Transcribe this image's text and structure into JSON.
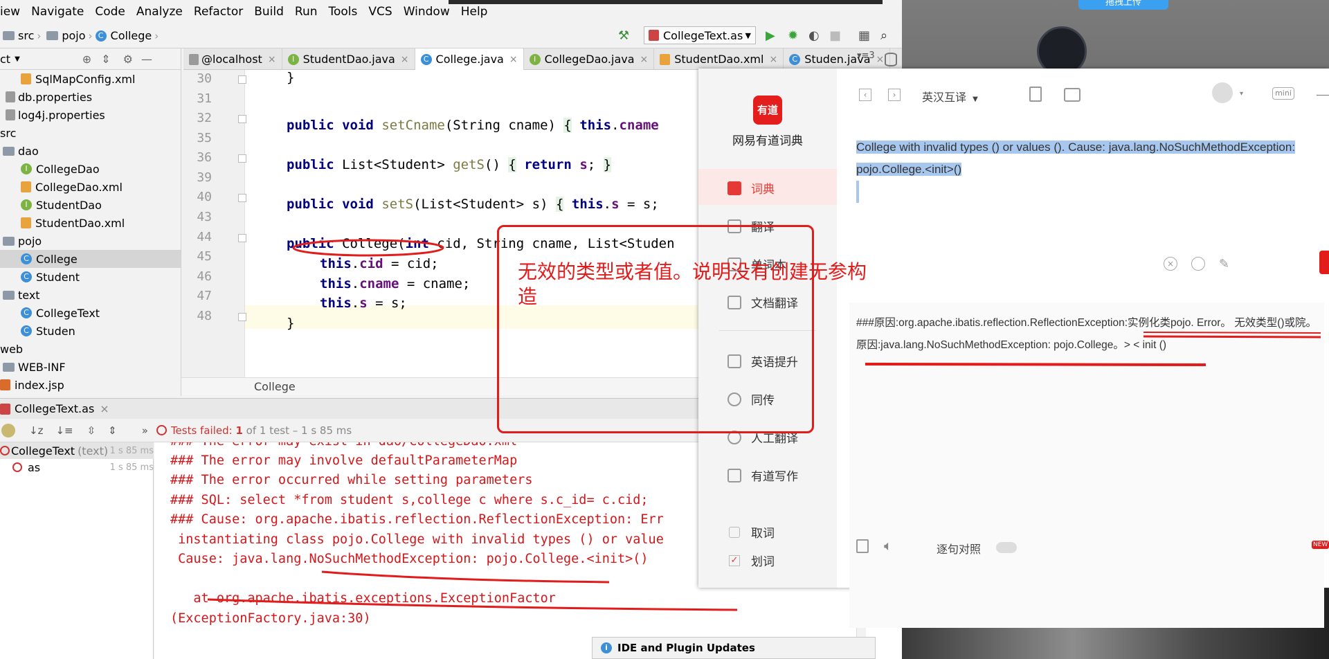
{
  "menu": [
    "iew",
    "Navigate",
    "Code",
    "Analyze",
    "Refactor",
    "Build",
    "Run",
    "Tools",
    "VCS",
    "Window",
    "Help"
  ],
  "nav": {
    "src": "src",
    "pojo": "pojo",
    "college": "College",
    "run_config": "CollegeText.as"
  },
  "tabs": [
    {
      "label": "@localhost",
      "active": false
    },
    {
      "label": "StudentDao.java",
      "active": false
    },
    {
      "label": "College.java",
      "active": true
    },
    {
      "label": "CollegeDao.java",
      "active": false
    },
    {
      "label": "StudentDao.xml",
      "active": false
    },
    {
      "label": "Studen.java",
      "active": false
    }
  ],
  "tabs_overflow": "3",
  "project": {
    "header": "ct",
    "items": [
      {
        "label": "SqlMapConfig.xml",
        "icon": "xml",
        "indent": 30
      },
      {
        "label": "db.properties",
        "icon": "prop",
        "indent": 8
      },
      {
        "label": "log4j.properties",
        "icon": "prop",
        "indent": 8
      },
      {
        "label": "src",
        "icon": "none",
        "indent": 0
      },
      {
        "label": "dao",
        "icon": "folder",
        "indent": 0
      },
      {
        "label": "CollegeDao",
        "icon": "interface",
        "indent": 30
      },
      {
        "label": "CollegeDao.xml",
        "icon": "xml",
        "indent": 30
      },
      {
        "label": "StudentDao",
        "icon": "interface",
        "indent": 30
      },
      {
        "label": "StudentDao.xml",
        "icon": "xml",
        "indent": 30
      },
      {
        "label": "pojo",
        "icon": "folder",
        "indent": 0
      },
      {
        "label": "College",
        "icon": "class",
        "indent": 30,
        "selected": true
      },
      {
        "label": "Student",
        "icon": "class",
        "indent": 30
      },
      {
        "label": "text",
        "icon": "folder",
        "indent": 0
      },
      {
        "label": "CollegeText",
        "icon": "class",
        "indent": 30
      },
      {
        "label": "Studen",
        "icon": "class",
        "indent": 30
      },
      {
        "label": "web",
        "icon": "none",
        "indent": 0
      },
      {
        "label": "WEB-INF",
        "icon": "folder",
        "indent": 0
      },
      {
        "label": "index.jsp",
        "icon": "jsp",
        "indent": 0
      }
    ]
  },
  "editor": {
    "line_numbers": [
      "30",
      "31",
      "32",
      "35",
      "36",
      "39",
      "40",
      "43",
      "44",
      "45",
      "46",
      "47",
      "48"
    ],
    "breadcrumb": "College"
  },
  "run": {
    "tab_label": "CollegeText.as",
    "status_prefix": "Tests failed: ",
    "failed_count": "1",
    "status_suffix": " of 1 test – 1 s 85 ms",
    "tree": [
      {
        "name": "CollegeText",
        "note": "(text)",
        "time": "1 s 85 ms"
      },
      {
        "name": "as",
        "note": "",
        "time": "1 s 85 ms"
      }
    ]
  },
  "console_lines": [
    "### The error may exist in dao/CollegeDao.xml",
    "### The error may involve defaultParameterMap",
    "### The error occurred while setting parameters",
    "### SQL: select *from student s,college c where s.c_id= c.cid;",
    "### Cause: org.apache.ibatis.reflection.ReflectionException: Err",
    " instantiating class pojo.College with invalid types () or value",
    " Cause: java.lang.NoSuchMethodException: pojo.College.<init>()",
    "",
    "   at org.apache.ibatis.exceptions.ExceptionFactor",
    "(ExceptionFactory.java:30)"
  ],
  "notification": "IDE and Plugin Updates",
  "annotation_text": "无效的类型或者值。说明没有创建无参构造",
  "dict": {
    "logo": "有道",
    "app_name": "网易有道词典",
    "mode": "英汉互译",
    "mini": "mini",
    "nav": [
      "词典",
      "翻译",
      "单词本",
      "文档翻译",
      "英语提升",
      "同传",
      "人工翻译",
      "有道写作"
    ],
    "options": [
      "取词",
      "划词"
    ],
    "source_text": "College with invalid types () or values ().  Cause: java.lang.NoSuchMethodException: pojo.College.<init>()",
    "translation": "###原因:org.apache.ibatis.reflection.ReflectionException:实例化类pojo. Error。 无效类型()或院。 原因:java.lang.NoSuchMethodException: pojo.College。> < init ()",
    "sentence_compare": "逐句对照",
    "new_badge": "NEW",
    "upload_label": "拖拽上传"
  },
  "colors": {
    "accent_red": "#e21b1b",
    "keyword": "#000080",
    "console_red": "#d3171b",
    "select_blue": "#a7c7ef"
  }
}
